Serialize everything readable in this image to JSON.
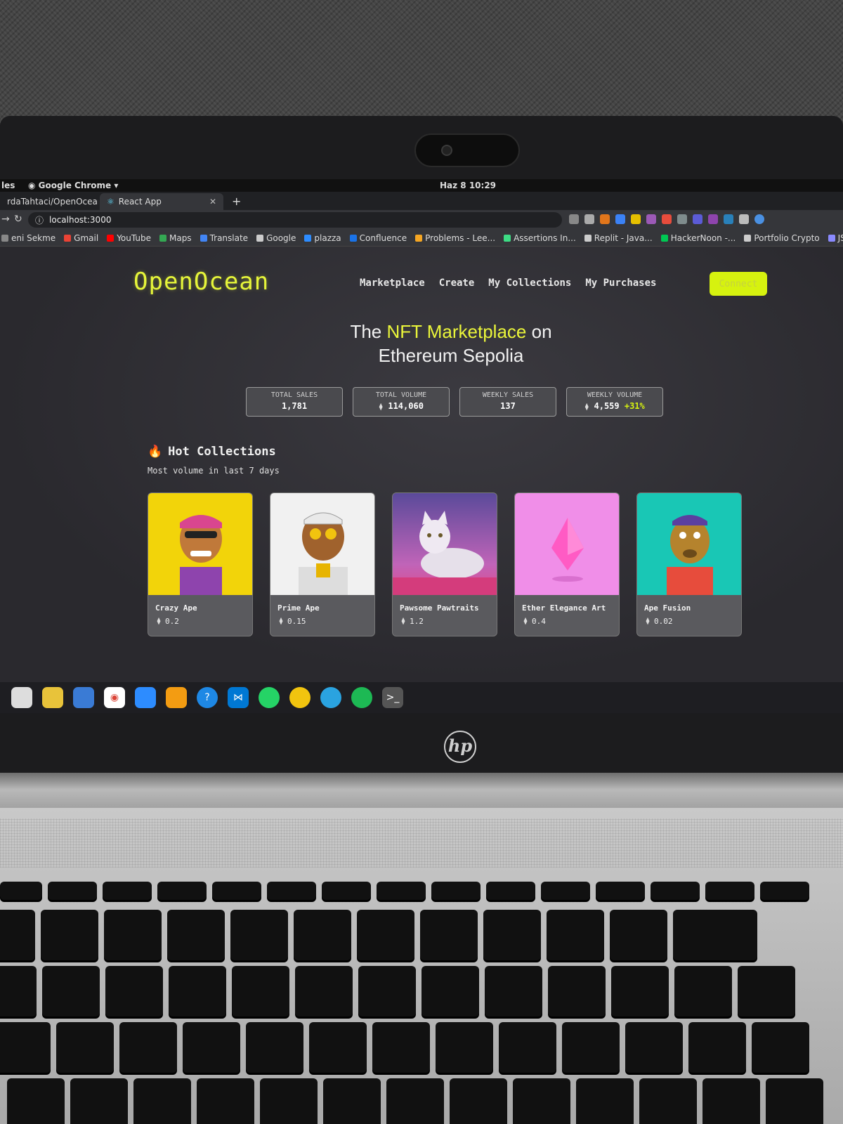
{
  "os_bar": {
    "activities": "les",
    "app_name": "Google Chrome",
    "clock": "Haz 8  10:29"
  },
  "browser": {
    "tabs": [
      {
        "label": "rdaTahtaci/OpenOcean"
      },
      {
        "label": "React App"
      }
    ],
    "address": "localhost:3000",
    "bookmarks": [
      {
        "label": "eni Sekme",
        "color": "#888888"
      },
      {
        "label": "Gmail",
        "color": "#ea4335"
      },
      {
        "label": "YouTube",
        "color": "#ff0000"
      },
      {
        "label": "Maps",
        "color": "#34a853"
      },
      {
        "label": "Translate",
        "color": "#4285f4"
      },
      {
        "label": "Google",
        "color": "#cccccc"
      },
      {
        "label": "plazza",
        "color": "#2d8cff"
      },
      {
        "label": "Confluence",
        "color": "#1a73e8"
      },
      {
        "label": "Problems - Lee...",
        "color": "#f5a623"
      },
      {
        "label": "Assertions In...",
        "color": "#3ddc84"
      },
      {
        "label": "Replit - Java...",
        "color": "#cccccc"
      },
      {
        "label": "HackerNoon -...",
        "color": "#00c853"
      },
      {
        "label": "Portfolio Crypto",
        "color": "#cccccc"
      },
      {
        "label": "JSON-RPC API...",
        "color": "#8a8aff"
      }
    ]
  },
  "site": {
    "logo": "OpenOcean",
    "nav": [
      "Marketplace",
      "Create",
      "My Collections",
      "My Purchases"
    ],
    "connect_label": "Connect",
    "accent_color": "#d6f20f",
    "hero": {
      "pre": "The ",
      "highlight": "NFT Marketplace",
      "post": " on",
      "line2": "Ethereum Sepolia"
    },
    "stats": [
      {
        "label": "TOTAL SALES",
        "value": "1,781"
      },
      {
        "label": "TOTAL VOLUME",
        "value": "114,060",
        "eth": true
      },
      {
        "label": "WEEKLY SALES",
        "value": "137"
      },
      {
        "label": "WEEKLY VOLUME",
        "value": "4,559",
        "eth": true,
        "change": "+31%"
      }
    ],
    "section_title": "Hot Collections",
    "section_icon": "fire-icon",
    "section_subtitle": "Most volume in last 7 days",
    "collections": [
      {
        "name": "Crazy Ape",
        "price": "0.2",
        "bg": "#f2d40a"
      },
      {
        "name": "Prime Ape",
        "price": "0.15",
        "bg": "#f1f1f1"
      },
      {
        "name": "Pawsome Pawtraits",
        "price": "1.2",
        "bg": "#7a5ba8"
      },
      {
        "name": "Ether Elegance Art",
        "price": "0.4",
        "bg": "#f08ee8"
      },
      {
        "name": "Ape Fusion",
        "price": "0.02",
        "bg": "#19c7b5"
      }
    ]
  },
  "hardware": {
    "brand": "hp"
  }
}
